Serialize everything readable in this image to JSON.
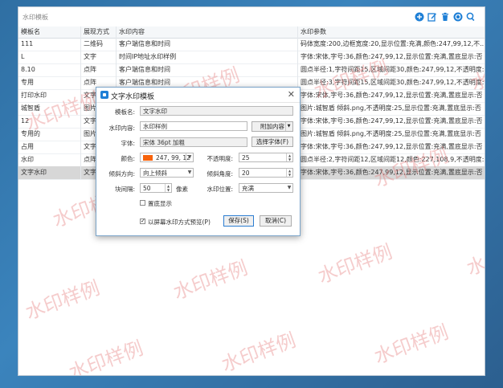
{
  "panel": {
    "title": "水印模板"
  },
  "toolbar": [
    {
      "name": "add-icon",
      "color": "#1e7fd6"
    },
    {
      "name": "edit-icon",
      "color": "#1e7fd6"
    },
    {
      "name": "delete-icon",
      "color": "#1e7fd6"
    },
    {
      "name": "refresh-icon",
      "color": "#1e7fd6"
    },
    {
      "name": "search-icon",
      "color": "#1e7fd6"
    }
  ],
  "table": {
    "headers": [
      "模板名",
      "展现方式",
      "水印内容",
      "水印参数"
    ],
    "rows": [
      [
        "111",
        "二维码",
        "客户端信息和时间",
        "码体宽度:200,边框宽度:20,显示位置:充满,颜色:247,99,12,不..."
      ],
      [
        "L",
        "文字",
        "时间IP地址水印样例",
        "字体:宋体,字号:36,颜色:247,99,12,显示位置:充满,置底显示:否"
      ],
      [
        "8.10",
        "点阵",
        "客户端信息和时间",
        "圆点半径:1,字符间距15,区域间距30,颜色:247,99,12,不透明度:80,置底显示:否"
      ],
      [
        "专用",
        "点阵",
        "客户端信息和时间",
        "圆点半径:3,字符间距15,区域间距30,颜色:247,99,12,不透明度:50,置底显示:否"
      ],
      [
        "打印水印",
        "文字",
        "",
        "字体:宋体,字号:36,颜色:247,99,12,显示位置:充满,置底显示:否"
      ],
      [
        "城智盾",
        "图片",
        "",
        "图片:城智盾 倾斜.png,不透明度:25,显示位置:充满,置底显示:否"
      ],
      [
        "12",
        "文字",
        "",
        "字体:宋体,字号:36,颜色:247,99,12,显示位置:充满,置底显示:否"
      ],
      [
        "专用的",
        "图片",
        "",
        "图片:城智盾 倾斜.png,不透明度:25,显示位置:充满,置底显示:否"
      ],
      [
        "占用",
        "文字",
        "",
        "字体:宋体,字号:36,颜色:247,99,12,显示位置:充满,置底显示:否"
      ],
      [
        "水印",
        "点阵",
        "",
        "圆点半径:2,字符间距12,区域间距12,颜色:227,108,9,不透明度:25,置底显示:否"
      ],
      [
        "文字水印",
        "文字",
        "",
        "字体:宋体,字号:36,颜色:247,99,12,显示位置:充满,置底显示:否"
      ]
    ],
    "selected_index": 10
  },
  "watermark_text": "水印样例",
  "dialog": {
    "title": "文字水印模板",
    "name_label": "模板名:",
    "name_value": "文字水印",
    "content_label": "水印内容:",
    "content_value": "水印样例",
    "append_button": "附加内容",
    "font_label": "字体:",
    "font_value": "宋体 36pt 加粗",
    "choose_font_button": "选择字体(F)",
    "color_label": "颜色:",
    "color_value": "247, 99, 12",
    "color_swatch": "#f7630c",
    "opacity_label": "不透明度:",
    "opacity_value": "25",
    "direction_label": "倾斜方向:",
    "direction_value": "向上倾斜",
    "angle_label": "倾斜角度:",
    "angle_value": "20",
    "spacing_label": "块间隔:",
    "spacing_value": "50",
    "spacing_unit": "像素",
    "position_label": "水印位置:",
    "position_value": "充满",
    "bottom_label": "置底显示",
    "bottom_checked": false,
    "screen_label": "以屏幕水印方式预览(P)",
    "screen_checked": true,
    "save_button": "保存(S)",
    "cancel_button": "取消(C)"
  },
  "accent_color": "#1e7fd6"
}
